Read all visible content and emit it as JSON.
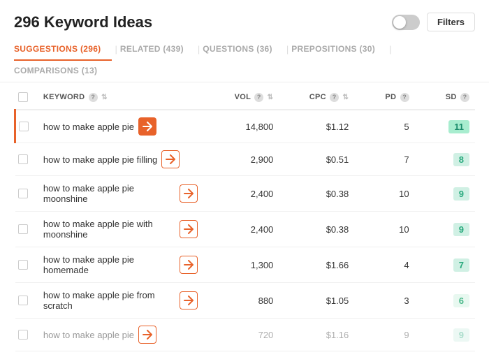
{
  "header": {
    "title": "296 Keyword Ideas",
    "filter_label": "Filters"
  },
  "tabs": [
    {
      "id": "suggestions",
      "label": "SUGGESTIONS (296)",
      "active": true
    },
    {
      "id": "related",
      "label": "RELATED (439)",
      "active": false
    },
    {
      "id": "questions",
      "label": "QUESTIONS (36)",
      "active": false
    },
    {
      "id": "prepositions",
      "label": "PREPOSITIONS (30)",
      "active": false
    },
    {
      "id": "comparisons",
      "label": "COMPARISONS (13)",
      "active": false
    }
  ],
  "table": {
    "columns": [
      {
        "id": "keyword",
        "label": "KEYWORD"
      },
      {
        "id": "vol",
        "label": "VOL"
      },
      {
        "id": "cpc",
        "label": "CPC"
      },
      {
        "id": "pd",
        "label": "PD"
      },
      {
        "id": "sd",
        "label": "SD"
      }
    ],
    "rows": [
      {
        "keyword": "how to make apple pie",
        "vol": "14,800",
        "cpc": "$1.12",
        "pd": "5",
        "sd": "11",
        "sd_style": "strong",
        "highlighted": true,
        "arrow_style": "filled"
      },
      {
        "keyword": "how to make apple pie filling",
        "vol": "2,900",
        "cpc": "$0.51",
        "pd": "7",
        "sd": "8",
        "sd_style": "medium",
        "highlighted": false,
        "arrow_style": "outline"
      },
      {
        "keyword": "how to make apple pie moonshine",
        "vol": "2,400",
        "cpc": "$0.38",
        "pd": "10",
        "sd": "9",
        "sd_style": "medium",
        "highlighted": false,
        "arrow_style": "outline"
      },
      {
        "keyword": "how to make apple pie with moonshine",
        "vol": "2,400",
        "cpc": "$0.38",
        "pd": "10",
        "sd": "9",
        "sd_style": "medium",
        "highlighted": false,
        "arrow_style": "outline"
      },
      {
        "keyword": "how to make apple pie homemade",
        "vol": "1,300",
        "cpc": "$1.66",
        "pd": "4",
        "sd": "7",
        "sd_style": "light",
        "highlighted": false,
        "arrow_style": "outline"
      },
      {
        "keyword": "how to make apple pie from scratch",
        "vol": "880",
        "cpc": "$1.05",
        "pd": "3",
        "sd": "6",
        "sd_style": "light",
        "highlighted": false,
        "arrow_style": "outline"
      },
      {
        "keyword": "how to make apple pie",
        "vol": "720",
        "cpc": "$1.16",
        "pd": "9",
        "sd": "9",
        "sd_style": "medium",
        "highlighted": false,
        "arrow_style": "outline",
        "partial": true
      }
    ]
  }
}
